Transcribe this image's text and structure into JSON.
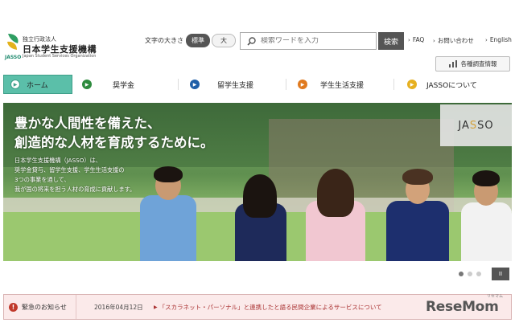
{
  "header": {
    "logo_sub": "独立行政法人",
    "logo_main": "日本学生支援機構",
    "logo_en": "Japan Student Services Organization",
    "logo_short": "JASSO",
    "fontsize_label": "文字の大きさ",
    "fontsize_standard": "標準",
    "fontsize_large": "大",
    "search_placeholder": "検索ワードを入力",
    "search_button": "検索",
    "links": [
      "FAQ",
      "お問い合わせ",
      "English"
    ],
    "survey_button": "各種調査情報"
  },
  "nav": {
    "items": [
      "ホーム",
      "奨学金",
      "留学生支援",
      "学生生活支援",
      "JASSOについて"
    ],
    "colors": [
      "#3e9e88",
      "#2e8b3e",
      "#1f5fa8",
      "#e07a1f",
      "#e6b020"
    ]
  },
  "hero": {
    "headline_1": "豊かな人間性を備えた、",
    "headline_2": "創造的な人材を育成するために。",
    "desc_1": "日本学生支援機構（JASSO）は、",
    "desc_2": "奨学金貸与、留学生支援、学生生活支援の",
    "desc_3": "3つの事業を通して、",
    "desc_4": "我が国の将来を担う人材の育成に貢献します。",
    "panel_logo_a": "JA",
    "panel_logo_s": "S",
    "panel_logo_b": "SO",
    "pause_label": "II"
  },
  "slider": {
    "total": 3,
    "active": 1
  },
  "news": {
    "label": "緊急のお知らせ",
    "date": "2016年04月12日",
    "text": "「スカラネット・パーソナル」と連携したと語る民間企業によるサービスについて"
  },
  "watermark": {
    "text": "ReseMom",
    "sub": "リセマム"
  }
}
